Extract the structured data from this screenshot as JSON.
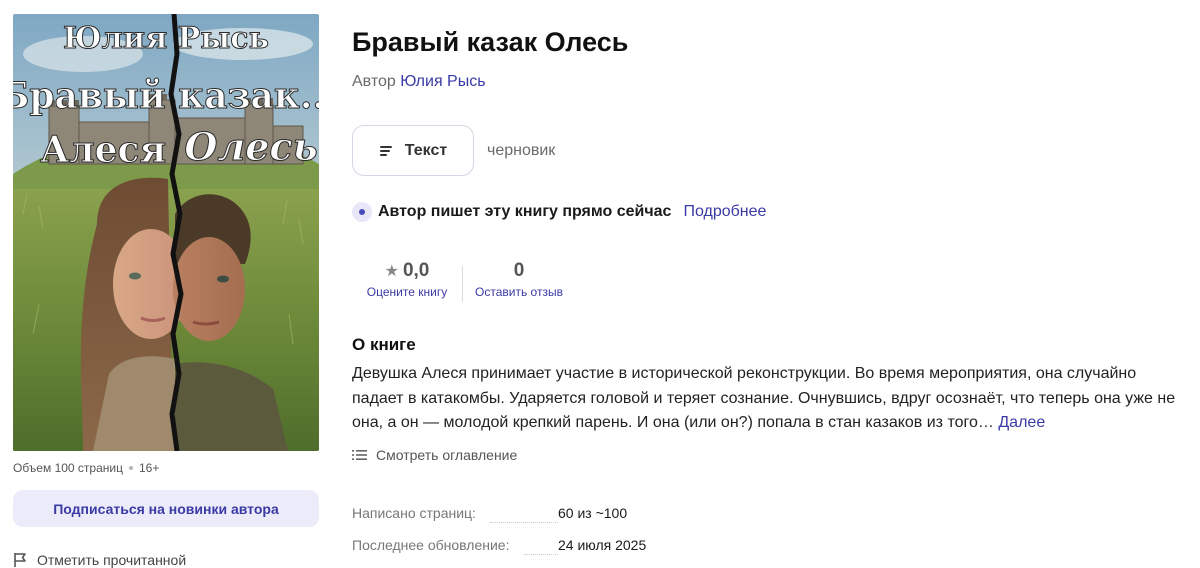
{
  "cover": {
    "author_text": "Юлия Рысь",
    "title_line1": "Бравый казак...",
    "title_line2_left": "Алеся",
    "title_line2_right": "Олесь"
  },
  "left": {
    "volume": "Объем 100 страниц",
    "age_rating": "16+",
    "subscribe_label": "Подписаться на новинки автора",
    "mark_read_label": "Отметить прочитанной"
  },
  "book": {
    "title": "Бравый казак Олесь",
    "author_prefix": "Автор",
    "author_name": "Юлия Рысь"
  },
  "format": {
    "button_label": "Текст",
    "status": "черновик"
  },
  "writing": {
    "text": "Автор пишет эту книгу прямо сейчас",
    "more_link": "Подробнее"
  },
  "stats": {
    "rating": "0,0",
    "rating_link": "Оцените книгу",
    "reviews": "0",
    "reviews_link": "Оставить отзыв"
  },
  "about": {
    "heading": "О книге",
    "text": "Девушка Алеся принимает участие в исторической реконструкции. Во время мероприятия, она случайно падает в катакомбы. Ударяется головой и теряет сознание. Очнувшись, вдруг осознаёт, что теперь она уже не она, а он — молодой крепкий парень. И она (или он?) попала в стан казаков из того…",
    "more_link": "Далее",
    "toc_label": "Смотреть оглавление"
  },
  "info": {
    "pages_label": "Написано страниц:",
    "pages_value": "60 из ~100",
    "updated_label": "Последнее обновление:",
    "updated_value": "24 июля 2025"
  },
  "colors": {
    "accent": "#3a3aa5",
    "subscribe_bg": "#ecebfa",
    "muted_text": "#6a6a6a"
  },
  "icons": {
    "format": "text-lines-icon",
    "star": "star-icon",
    "toc": "list-icon",
    "mark_read": "flag-icon",
    "writing": "pulse-dot-icon"
  }
}
